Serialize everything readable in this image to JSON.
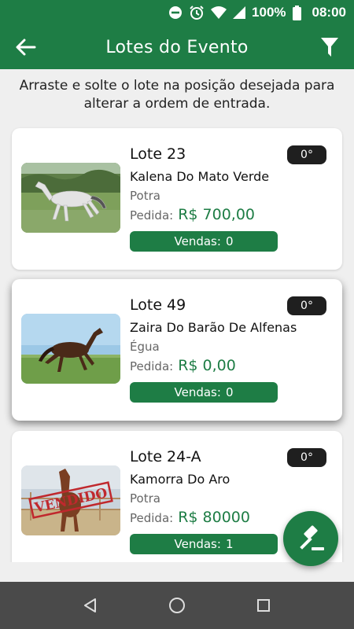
{
  "status_bar": {
    "battery_percent": "100%",
    "time": "08:00",
    "icons": [
      "do-not-disturb-icon",
      "alarm-icon",
      "wifi-icon",
      "signal-icon",
      "battery-icon"
    ]
  },
  "app_bar": {
    "title": "Lotes do Evento",
    "back_icon": "arrow-left-icon",
    "filter_icon": "filter-icon"
  },
  "instructions": "Arraste e solte o lote na posição desejada para alterar a ordem de entrada.",
  "lots": [
    {
      "lot": "Lote 23",
      "name": "Kalena Do Mato Verde",
      "category": "Potra",
      "price_label": "Pedida:",
      "price": "R$ 700,00",
      "sales_label": "Vendas:",
      "sales_count": "0",
      "degree": "0°",
      "sold": false,
      "horse_color": "gray-white"
    },
    {
      "lot": "Lote 49",
      "name": "Zaira Do Barão De Alfenas",
      "category": "Égua",
      "price_label": "Pedida:",
      "price": "R$ 0,00",
      "sales_label": "Vendas:",
      "sales_count": "0",
      "degree": "0°",
      "sold": false,
      "horse_color": "bay-brown"
    },
    {
      "lot": "Lote 24-A",
      "name": "Kamorra Do Aro",
      "category": "Potra",
      "price_label": "Pedida:",
      "price": "R$ 80000",
      "sales_label": "Vendas:",
      "sales_count": "1",
      "degree": "0°",
      "sold": true,
      "sold_stamp": "VENDIDO",
      "horse_color": "chestnut"
    }
  ],
  "fab_icon": "gavel-icon",
  "nav": {
    "back_icon": "nav-back-icon",
    "home_icon": "nav-home-icon",
    "recents_icon": "nav-recents-icon"
  },
  "colors": {
    "primary": "#1e7d45",
    "badge": "#1f1f1f",
    "sold_stamp": "#c0282d",
    "nav_bar": "#4a4a4a"
  }
}
